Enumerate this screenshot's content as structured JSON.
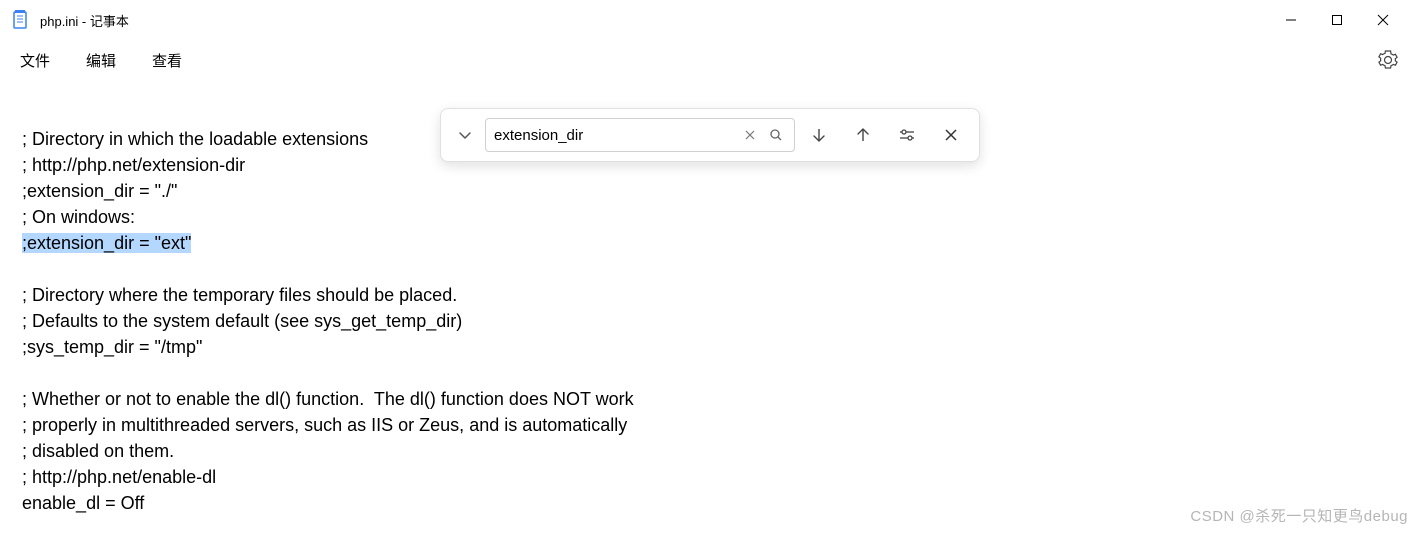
{
  "titlebar": {
    "title": "php.ini - 记事本"
  },
  "menubar": {
    "file": "文件",
    "edit": "编辑",
    "view": "查看"
  },
  "editor": {
    "line1": "; Directory in which the loadable extensions",
    "line2": "; http://php.net/extension-dir",
    "line3": ";extension_dir = \"./\"",
    "line4": "; On windows:",
    "line5": ";extension_dir = \"ext\"",
    "line6": "",
    "line7": "; Directory where the temporary files should be placed.",
    "line8": "; Defaults to the system default (see sys_get_temp_dir)",
    "line9": ";sys_temp_dir = \"/tmp\"",
    "line10": "",
    "line11": "; Whether or not to enable the dl() function.  The dl() function does NOT work",
    "line12": "; properly in multithreaded servers, such as IIS or Zeus, and is automatically",
    "line13": "; disabled on them.",
    "line14": "; http://php.net/enable-dl",
    "line15": "enable_dl = Off"
  },
  "find": {
    "value": "extension_dir"
  },
  "watermark": "CSDN @杀死一只知更鸟debug"
}
